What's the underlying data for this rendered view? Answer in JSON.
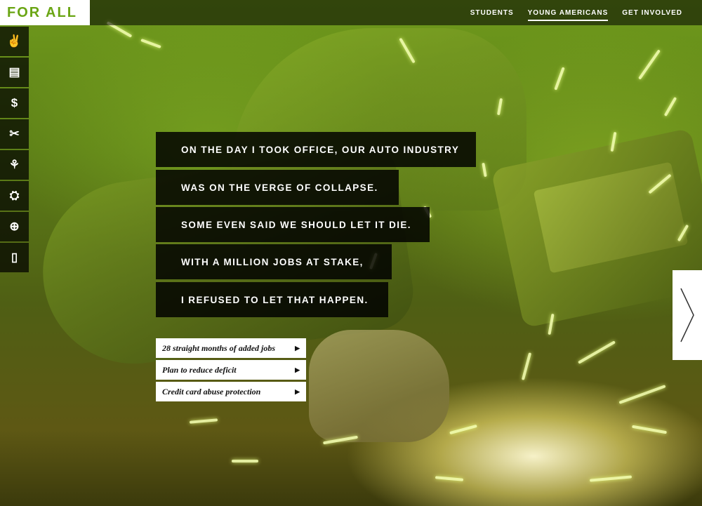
{
  "header": {
    "logo_text": "FOR ALL",
    "nav": [
      {
        "label": "STUDENTS",
        "active": false
      },
      {
        "label": "YOUNG AMERICANS",
        "active": true
      },
      {
        "label": "GET INVOLVED",
        "active": false
      }
    ]
  },
  "sidebar": {
    "items": [
      {
        "icon": "peace-hand-icon",
        "glyph": "✌"
      },
      {
        "icon": "document-icon",
        "glyph": "▤"
      },
      {
        "icon": "dollar-icon",
        "glyph": "$"
      },
      {
        "icon": "tools-icon",
        "glyph": "✂"
      },
      {
        "icon": "sprout-icon",
        "glyph": "⚘"
      },
      {
        "icon": "graduation-cap-icon",
        "glyph": "⛭"
      },
      {
        "icon": "health-plus-icon",
        "glyph": "⊕"
      },
      {
        "icon": "clipboard-icon",
        "glyph": "▯"
      }
    ]
  },
  "quote": {
    "lines": [
      "ON THE DAY I TOOK OFFICE, OUR AUTO INDUSTRY",
      "WAS ON THE VERGE OF COLLAPSE.",
      "SOME EVEN SAID WE SHOULD LET IT DIE.",
      "WITH A MILLION JOBS AT STAKE,",
      "I REFUSED TO LET THAT HAPPEN."
    ]
  },
  "links": [
    {
      "label": "28 straight months of added jobs"
    },
    {
      "label": "Plan to reduce deficit"
    },
    {
      "label": "Credit card abuse protection"
    }
  ],
  "next_button": {
    "icon": "chevron-right-icon"
  }
}
